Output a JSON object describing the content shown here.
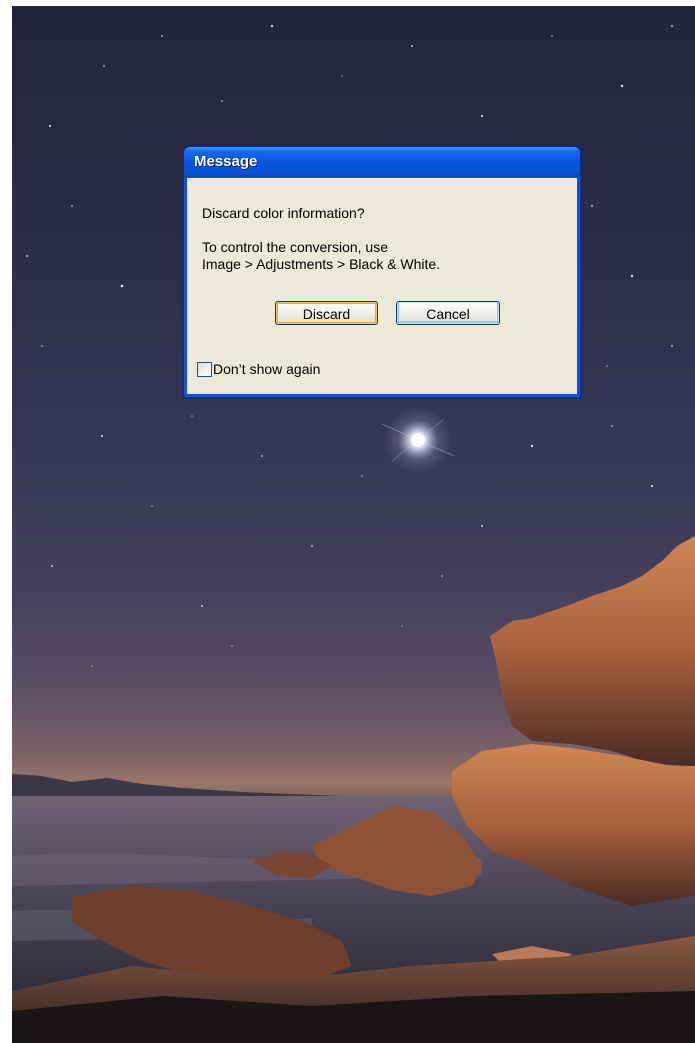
{
  "dialog": {
    "title": "Message",
    "question": "Discard color information?",
    "hint_line_1": "To control the conversion, use",
    "hint_line_2": "Image > Adjustments > Black & White.",
    "discard_label": "Discard",
    "cancel_label": "Cancel",
    "checkbox_label": "Don’t show again",
    "checkbox_checked": false
  },
  "colors": {
    "title_bar": "#0a54e3",
    "dialog_face": "#ece9d8",
    "default_button_focus": "#e7a93a"
  }
}
